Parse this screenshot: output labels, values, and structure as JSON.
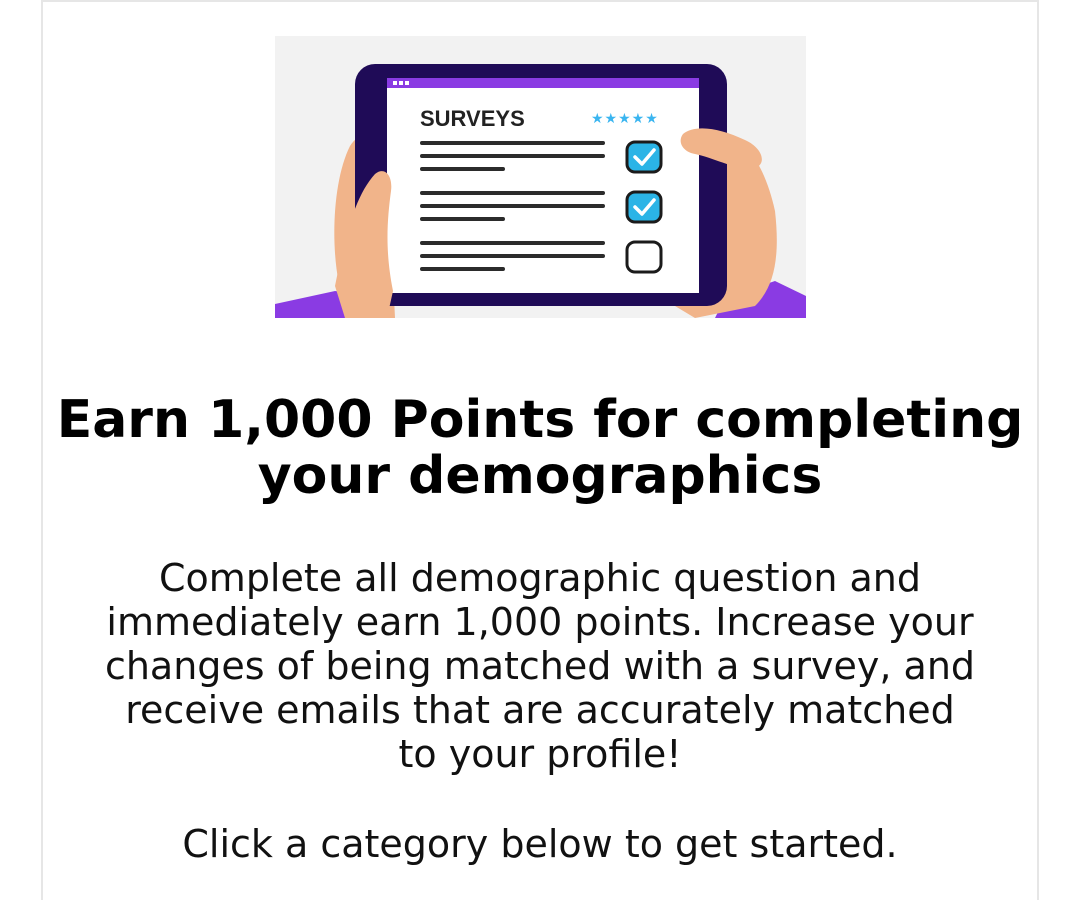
{
  "hero": {
    "screen_label": "SURVEYS",
    "rating_stars": "★★★★★",
    "checkbox_states": [
      true,
      true,
      false
    ],
    "colors": {
      "tablet_frame": "#1f0b57",
      "accent_purple": "#8a3be3",
      "check_blue": "#2bb4e6",
      "star_blue": "#3ab5f0",
      "skin": "#f1b48a",
      "background": "#f2f2f2"
    }
  },
  "content": {
    "title": "Earn 1,000 Points for completing your demographics",
    "description": "Complete all demographic question and immediately earn 1,000 points. Increase your changes of being matched with a survey, and receive emails that are accurately matched to your profile!",
    "cta": "Click a category below to get started."
  }
}
